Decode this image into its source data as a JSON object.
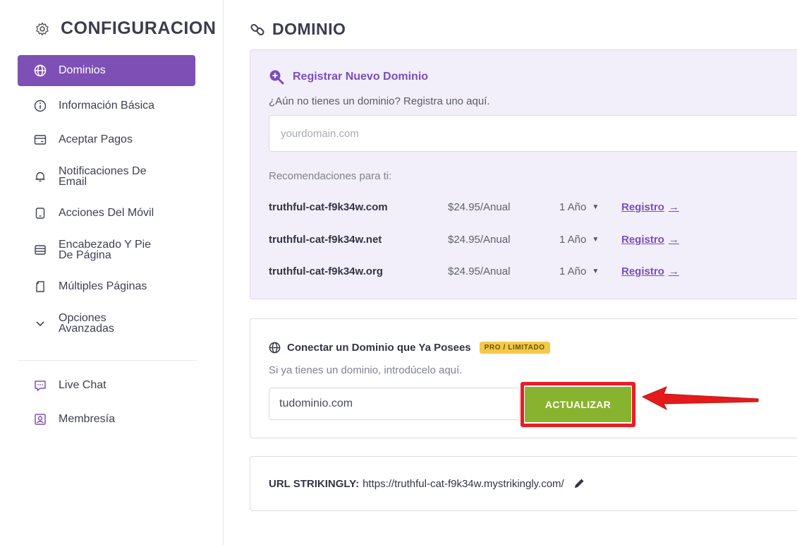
{
  "sidebar": {
    "title": "CONFIGURACION",
    "items": [
      {
        "label": "Dominios",
        "icon": "globe-icon",
        "active": true
      },
      {
        "label": "Información Básica",
        "icon": "info-icon"
      },
      {
        "label": "Aceptar Pagos",
        "icon": "credit-card-icon"
      },
      {
        "label_line1": "Notificaciones De",
        "label_line2": "Email",
        "icon": "bell-icon"
      },
      {
        "label": "Acciones Del Móvil",
        "icon": "mobile-icon"
      },
      {
        "label_line1": "Encabezado Y Pie",
        "label_line2": "De Página",
        "icon": "header-footer-icon"
      },
      {
        "label": "Múltiples Páginas",
        "icon": "pages-icon"
      },
      {
        "label_line1": "Opciones",
        "label_line2": "Avanzadas",
        "icon": "chevron-down-icon"
      }
    ],
    "extra_items": [
      {
        "label": "Live Chat",
        "icon": "chat-icon"
      },
      {
        "label": "Membresía",
        "icon": "member-icon"
      }
    ]
  },
  "main": {
    "title": "DOMINIO",
    "register": {
      "heading": "Registrar Nuevo Dominio",
      "subtitle": "¿Aún no tienes un dominio? Registra uno aquí.",
      "placeholder": "yourdomain.com",
      "recommendations_label": "Recomendaciones para ti:",
      "recommendations": [
        {
          "domain": "truthful-cat-f9k34w.com",
          "price": "$24.95/Anual",
          "period": "1 Año",
          "action": "Registro"
        },
        {
          "domain": "truthful-cat-f9k34w.net",
          "price": "$24.95/Anual",
          "period": "1 Año",
          "action": "Registro"
        },
        {
          "domain": "truthful-cat-f9k34w.org",
          "price": "$24.95/Anual",
          "period": "1 Año",
          "action": "Registro"
        }
      ]
    },
    "connect": {
      "heading": "Conectar un Dominio que Ya Posees",
      "badge": "PRO / LIMITADO",
      "subtitle": "Si ya tienes un dominio, introdúcelo aquí.",
      "input_value": "tudominio.com",
      "button_label": "ACTUALIZAR"
    },
    "url": {
      "label": "URL STRIKINGLY:",
      "value": "https://truthful-cat-f9k34w.mystrikingly.com/"
    }
  },
  "colors": {
    "accent": "#7e50b6",
    "button_green": "#88b32e",
    "highlight_red": "#ec1c24",
    "badge_yellow": "#f3c94a"
  }
}
